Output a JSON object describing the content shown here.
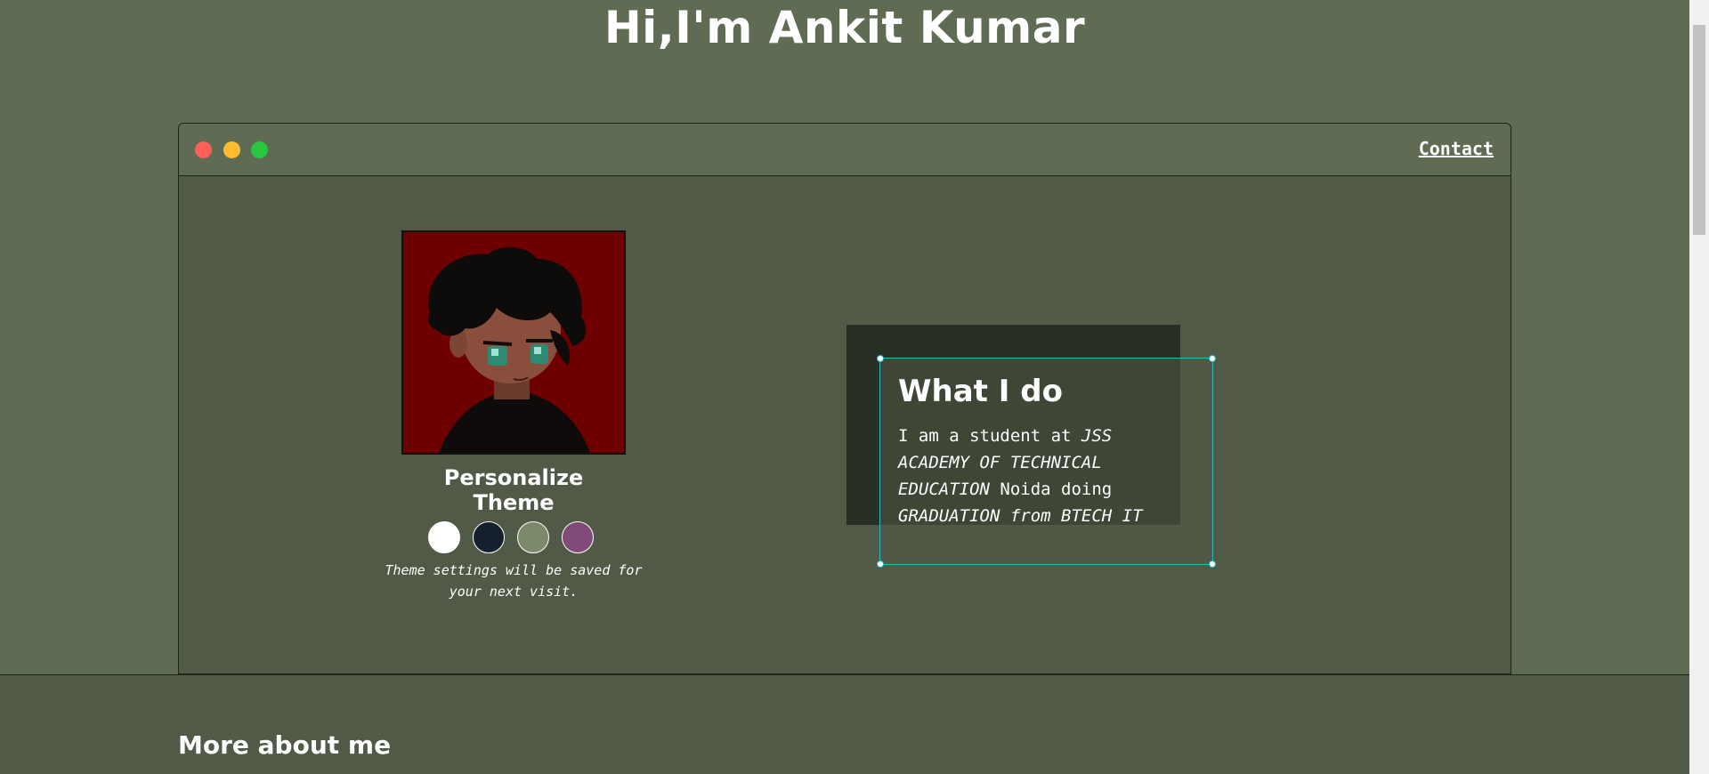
{
  "hero": {
    "title": "Hi,I'm Ankit Kumar"
  },
  "window": {
    "controls": [
      "close",
      "minimize",
      "maximize"
    ],
    "nav": {
      "contact_label": "Contact"
    }
  },
  "profile": {
    "avatar_icon": "cartoon-avatar-portrait",
    "theme_title": "Personalize Theme",
    "theme_swatches": [
      {
        "name": "light",
        "color": "#ffffff"
      },
      {
        "name": "blue",
        "color": "#17202d"
      },
      {
        "name": "green",
        "color": "#7c8a6b"
      },
      {
        "name": "purple",
        "color": "#814b78"
      }
    ],
    "theme_note": "Theme settings will be saved for your next visit."
  },
  "what_i_do": {
    "title": "What I do",
    "text_1": "I am a student at ",
    "text_2": "JSS ACADEMY OF TECHNICAL EDUCATION",
    "text_3": " Noida doing ",
    "text_4": "GRADUATION from BTECH IT"
  },
  "more": {
    "title": "More about me"
  },
  "colors": {
    "background": "#5f6b53",
    "panel": "#505a46",
    "card_shadow": "#292f24",
    "selection": "#2bb7c6"
  }
}
